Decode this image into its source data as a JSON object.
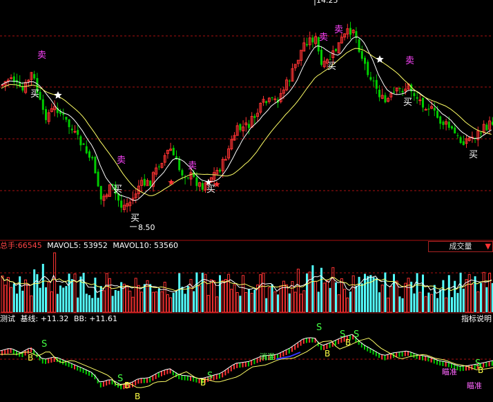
{
  "chart_data": [
    {
      "type": "candlestick",
      "panel": "price",
      "grid": "dashed red horizontal",
      "annotations": {
        "high_label": "14.25",
        "low_label": "8.50",
        "buy_label": "买",
        "sell_label": "卖"
      },
      "series": [
        {
          "name": "price",
          "color_up": "#ff3333",
          "color_down": "#00cc00"
        },
        {
          "name": "MA short",
          "color": "#ffffff"
        },
        {
          "name": "MA long",
          "color": "#ffff66"
        }
      ]
    },
    {
      "type": "bar",
      "panel": "volume",
      "header": {
        "total_label": "总手:",
        "total_value": "66545",
        "mavol5_label": "MAVOL5:",
        "mavol5_value": "53952",
        "mavol10_label": "MAVOL10:",
        "mavol10_value": "53560"
      },
      "selector": {
        "label": "成交量",
        "arrow": "▼"
      },
      "colors": {
        "up": "#ff3333",
        "down": "#54ffff"
      }
    },
    {
      "type": "line",
      "panel": "indicator",
      "header": {
        "name_label": "测试",
        "base_label": "基线:",
        "base_value": "+11.32",
        "bb_label": "BB:",
        "bb_value": "+11.61"
      },
      "help_label": "指标说明",
      "annotations": {
        "s_label": "S",
        "b_label": "B",
        "text_1": "消混",
        "text_2": "瞄准"
      }
    }
  ]
}
